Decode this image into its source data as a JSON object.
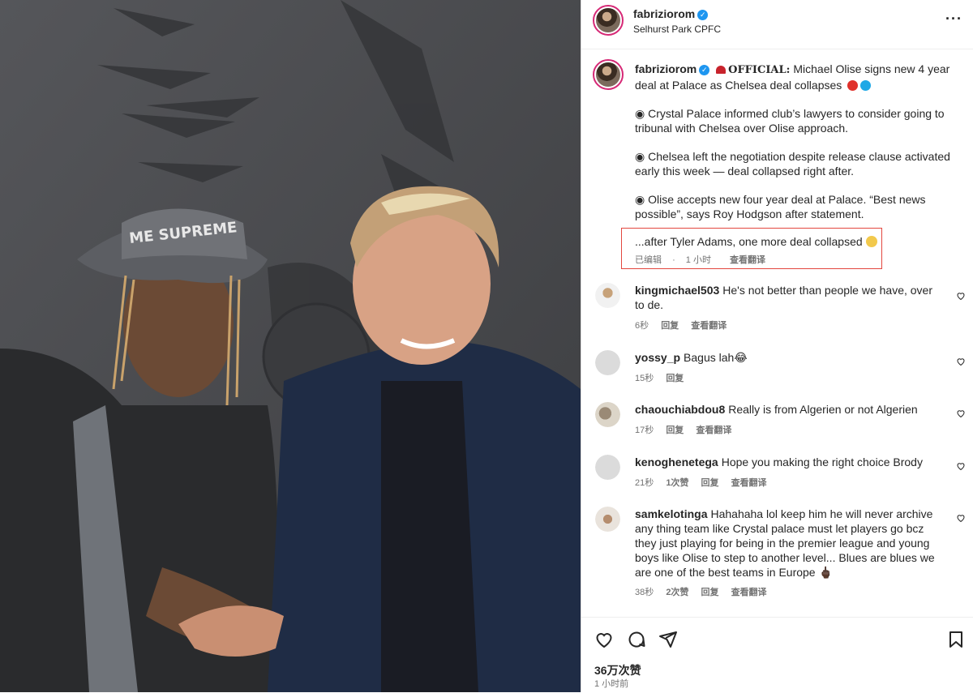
{
  "post": {
    "username": "fabriziorom",
    "location": "Selhurst Park CPFC",
    "more_icon": "more-horizontal-icon"
  },
  "caption": {
    "username": "fabriziorom",
    "official_label": "OFFICIAL:",
    "headline": " Michael Olise signs new 4 year deal at Palace as Chelsea deal collapses",
    "bullets": [
      "◉ Crystal Palace informed club’s lawyers to consider going to tribunal with Chelsea over Olise approach.",
      "◉ Chelsea left the negotiation despite release clause activated early this week — deal collapsed right after.",
      "◉ Olise accepts new four year deal at Palace. “Best news possible”, says Roy Hodgson after statement."
    ],
    "last_line": "...after Tyler Adams, one more deal collapsed",
    "edited": "已编辑",
    "sep": "·",
    "edited_time": "1 小时",
    "translate": "查看翻译",
    "colors": {
      "red_dot": "#e0312b",
      "blue_dot": "#1ea8e6",
      "highlight_border": "#e3473f"
    }
  },
  "comments": [
    {
      "user": "kingmichael503",
      "text": "He's not better than people we have, over to de.",
      "time": "6秒",
      "likes": "",
      "reply": "回复",
      "translate": "查看翻译"
    },
    {
      "user": "yossy_p",
      "text": "Bagus lah😂",
      "time": "15秒",
      "likes": "",
      "reply": "回复",
      "translate": ""
    },
    {
      "user": "chaouchiabdou8",
      "text": "Really is from Algerien or not Algerien",
      "time": "17秒",
      "likes": "",
      "reply": "回复",
      "translate": "查看翻译"
    },
    {
      "user": "kenoghenetega",
      "text": "Hope you making the right choice Brody",
      "time": "21秒",
      "likes": "1次赞",
      "reply": "回复",
      "translate": "查看翻译"
    },
    {
      "user": "samkelotinga",
      "text": "Hahahaha lol keep him he will never archive any thing team like Crystal palace must let players go bcz they just playing for being in the premier league and young boys like Olise to step to another level... Blues are blues we are one of the best teams in Europe 🖕🏿",
      "time": "38秒",
      "likes": "2次赞",
      "reply": "回复",
      "translate": "查看翻译"
    }
  ],
  "footer": {
    "likes": "36万次赞",
    "time": "1 小时前"
  }
}
